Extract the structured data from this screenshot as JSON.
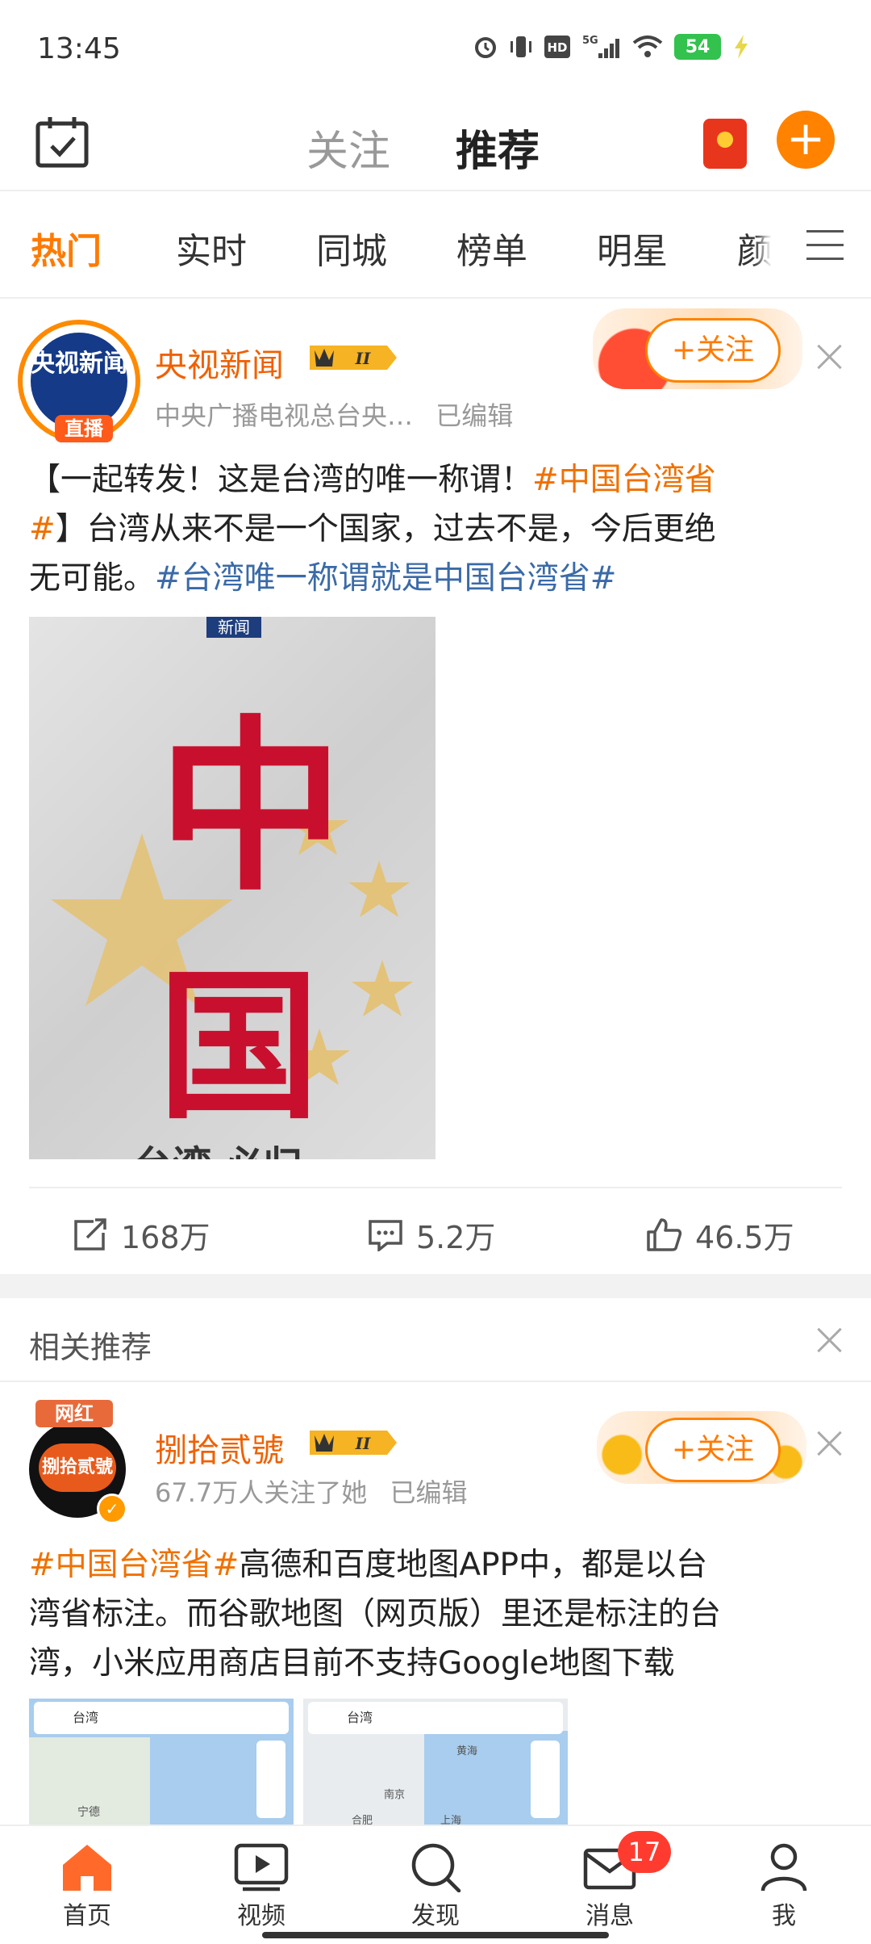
{
  "status_bar": {
    "time": "13:45",
    "battery": "54",
    "network": "5G"
  },
  "top_bar": {
    "tabs": [
      "关注",
      "推荐"
    ],
    "active_tab": "推荐"
  },
  "channels": {
    "items": [
      "热门",
      "实时",
      "同城",
      "榜单",
      "明星",
      "颜"
    ],
    "active": "热门"
  },
  "post1": {
    "author": "央视新闻",
    "avatar_text": "央视新闻",
    "avatar_badge": "直播",
    "vip_level": "II",
    "meta_source": "中央广播电视总台央…",
    "meta_edited": "已编辑",
    "follow_label": "+关注",
    "text_1": "【一起转发！这是台湾的唯一称谓！",
    "topic_1": "#中国台湾省",
    "topic_1b": "#",
    "text_2": "】台湾从来不是一个国家，过去不是，今后更绝",
    "text_3": "无可能。",
    "topic_2": "#台湾唯一称谓就是中国台湾省#",
    "image": {
      "tag": "新闻",
      "chars": [
        "中",
        "国"
      ],
      "caption_fragment": "台湾 必归"
    },
    "actions": {
      "reposts": "168万",
      "comments": "5.2万",
      "likes": "46.5万"
    }
  },
  "related": {
    "title": "相关推荐"
  },
  "post2": {
    "author": "捌拾贰號",
    "avatar_text": "捌拾贰號",
    "avatar_tag": "网红",
    "vip_level": "II",
    "meta_followers": "67.7万人关注了她",
    "meta_edited": "已编辑",
    "follow_label": "+关注",
    "topic": "#中国台湾省#",
    "text_1": "高德和百度地图APP中，都是以台",
    "text_2": "湾省标注。而谷歌地图（网页版）里还是标注的台",
    "text_3": "湾，小米应用商店目前不支持Google地图下载",
    "maps": [
      {
        "search": "台湾",
        "labels": [
          "宁德"
        ]
      },
      {
        "search": "台湾",
        "labels": [
          "南京",
          "合肥",
          "上海",
          "黄海"
        ]
      }
    ]
  },
  "bottom_nav": {
    "items": [
      "首页",
      "视频",
      "发现",
      "消息",
      "我"
    ],
    "active": "首页",
    "messages_badge": "17"
  },
  "colors": {
    "accent": "#ff8200",
    "topic": "#f07000",
    "topic_blue": "#3a6aa8",
    "flag_red": "#c8102e",
    "star_gold": "#e3c27a"
  }
}
